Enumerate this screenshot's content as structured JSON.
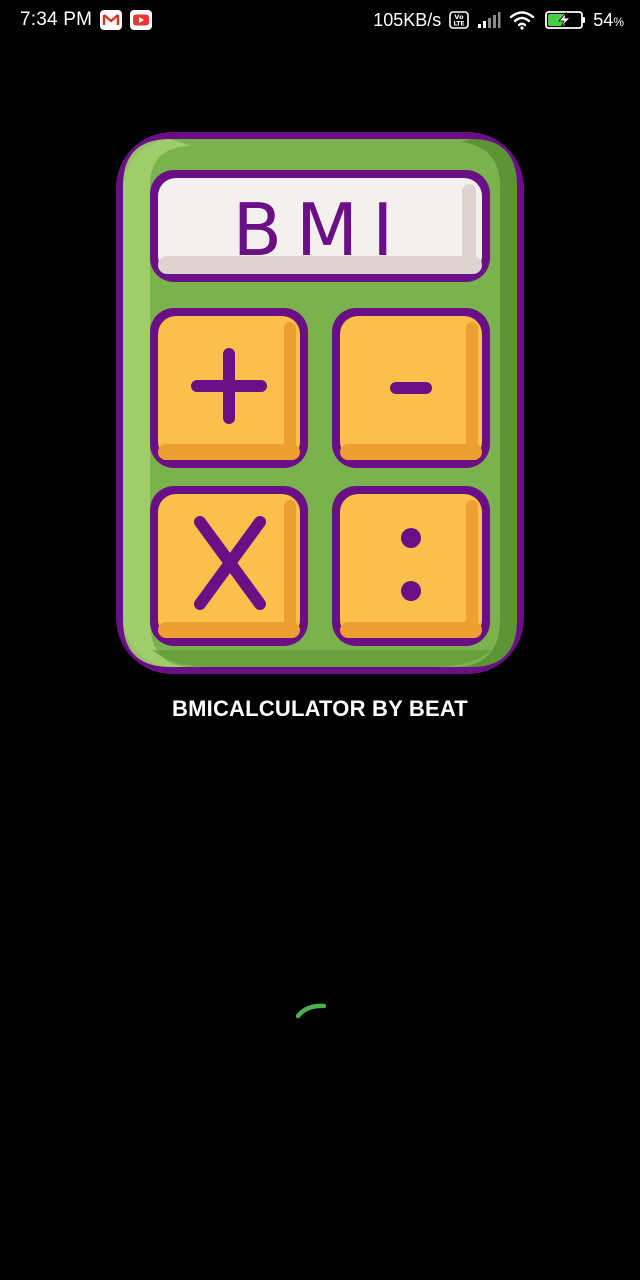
{
  "status_bar": {
    "time": "7:34 PM",
    "network_speed": "105KB/s",
    "volte_label_top": "Vo",
    "volte_label_bottom": "LTE",
    "battery_percent": "54",
    "battery_percent_unit": "%",
    "notification_icons": [
      "gmail-icon",
      "youtube-icon"
    ],
    "system_icons": [
      "volte-icon",
      "signal-icon",
      "wifi-icon",
      "battery-charging-icon"
    ]
  },
  "logo": {
    "display_text": "BMI",
    "keys": [
      "+",
      "-",
      "X",
      ":"
    ],
    "colors": {
      "outline": "#6a0f86",
      "body": "#7ab34d",
      "body_light": "#a3cf6d",
      "body_shadow": "#5d9436",
      "display": "#f4f0ee",
      "display_shadow": "#ddd4d2",
      "key": "#fbc04c",
      "key_shadow": "#ed9f32"
    }
  },
  "app_name": "BMICALCULATOR BY BEAT",
  "spinner": {
    "color": "#4caf50"
  }
}
